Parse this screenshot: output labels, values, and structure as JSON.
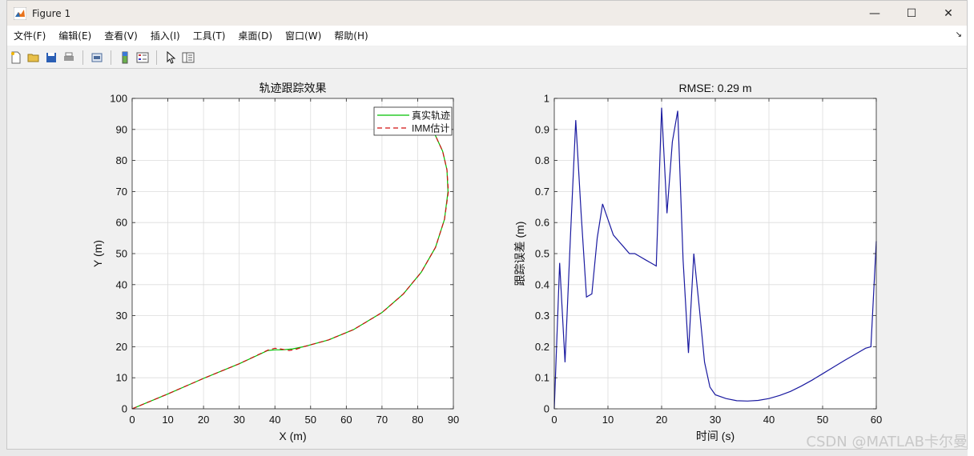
{
  "window": {
    "title": "Figure 1"
  },
  "menu": [
    "文件(F)",
    "编辑(E)",
    "查看(V)",
    "插入(I)",
    "工具(T)",
    "桌面(D)",
    "窗口(W)",
    "帮助(H)"
  ],
  "toolbar": [
    "new-file-icon",
    "open-folder-icon",
    "save-icon",
    "print-icon",
    "print-preview-icon",
    "colorbar-icon",
    "legend-icon",
    "pointer-icon",
    "property-editor-icon"
  ],
  "watermark": "CSDN @MATLAB卡尔曼",
  "chart_data": [
    {
      "type": "line",
      "title": "轨迹跟踪效果",
      "xlabel": "X (m)",
      "ylabel": "Y (m)",
      "xlim": [
        0,
        90
      ],
      "ylim": [
        0,
        100
      ],
      "xticks": [
        0,
        10,
        20,
        30,
        40,
        50,
        60,
        70,
        80,
        90
      ],
      "yticks": [
        0,
        10,
        20,
        30,
        40,
        50,
        60,
        70,
        80,
        90,
        100
      ],
      "grid": true,
      "legend_position": "top-right",
      "series": [
        {
          "name": "真实轨迹",
          "color": "#00c000",
          "style": "solid",
          "x": [
            0,
            10,
            20,
            30,
            38,
            40,
            42,
            45,
            48,
            55,
            62,
            70,
            76,
            81,
            85,
            87.5,
            88.5,
            88.2,
            87,
            85,
            84
          ],
          "y": [
            0,
            4.8,
            9.8,
            14.5,
            18.8,
            19,
            19,
            19.3,
            20,
            22.2,
            25.5,
            31,
            37,
            44,
            52,
            61,
            70,
            77,
            83,
            88,
            90
          ]
        },
        {
          "name": "IMM估计",
          "color": "#d01010",
          "style": "dashed",
          "x": [
            0,
            10,
            20,
            30,
            38,
            40,
            42,
            44,
            46,
            48,
            55,
            62,
            70,
            76,
            81,
            85,
            87.5,
            88.6,
            88.2,
            87,
            85,
            84
          ],
          "y": [
            0,
            4.8,
            9.8,
            14.5,
            18.9,
            19.5,
            19.2,
            18.8,
            19.2,
            20,
            22.2,
            25.5,
            31,
            37,
            44,
            52,
            61,
            70,
            77,
            83,
            88,
            90
          ]
        }
      ]
    },
    {
      "type": "line",
      "title": "RMSE: 0.29 m",
      "xlabel": "时间 (s)",
      "ylabel": "跟踪误差 (m)",
      "xlim": [
        0,
        60
      ],
      "ylim": [
        0,
        1
      ],
      "xticks": [
        0,
        10,
        20,
        30,
        40,
        50,
        60
      ],
      "yticks": [
        0,
        0.1,
        0.2,
        0.3,
        0.4,
        0.5,
        0.6,
        0.7,
        0.8,
        0.9,
        1
      ],
      "grid": true,
      "series": [
        {
          "color": "#1a1aa0",
          "x": [
            0,
            1,
            2,
            3,
            4,
            5,
            6,
            7,
            8,
            9,
            10,
            11,
            12,
            13,
            14,
            15,
            16,
            17,
            18,
            19,
            20,
            21,
            22,
            23,
            24,
            25,
            26,
            27,
            28,
            29,
            30,
            32,
            34,
            36,
            38,
            40,
            42,
            44,
            46,
            48,
            50,
            52,
            54,
            56,
            58,
            59,
            60
          ],
          "y": [
            0,
            0.47,
            0.15,
            0.55,
            0.93,
            0.63,
            0.36,
            0.37,
            0.55,
            0.66,
            0.61,
            0.56,
            0.54,
            0.52,
            0.5,
            0.5,
            0.49,
            0.48,
            0.47,
            0.46,
            0.97,
            0.63,
            0.86,
            0.96,
            0.48,
            0.18,
            0.5,
            0.33,
            0.15,
            0.07,
            0.045,
            0.033,
            0.026,
            0.025,
            0.027,
            0.033,
            0.043,
            0.056,
            0.073,
            0.092,
            0.113,
            0.134,
            0.155,
            0.175,
            0.195,
            0.2,
            0.54
          ]
        }
      ]
    }
  ]
}
